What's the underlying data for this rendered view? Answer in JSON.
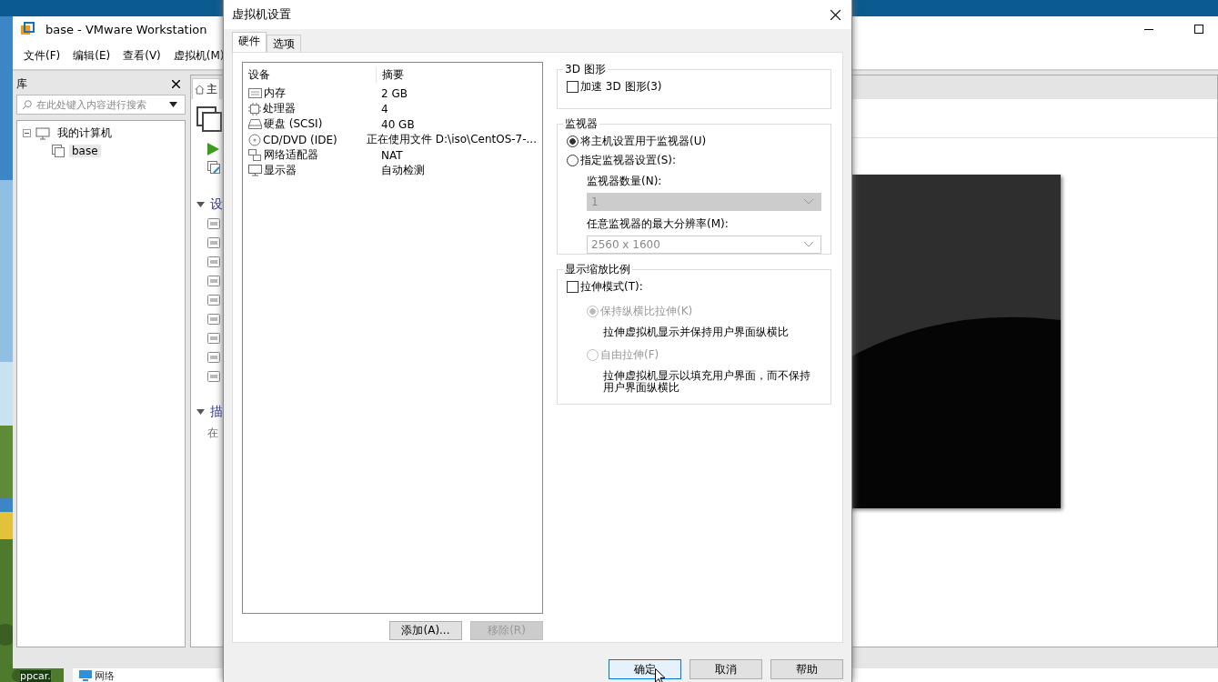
{
  "desktop": {
    "icons": [
      {
        "label": "ppcar."
      },
      {
        "label": "网络"
      }
    ]
  },
  "main_window": {
    "title": "base - VMware Workstation",
    "menu": [
      "文件(F)",
      "编辑(E)",
      "查看(V)",
      "虚拟机(M)"
    ],
    "library": {
      "title": "库",
      "search": {
        "placeholder": "在此处键入内容进行搜索"
      },
      "tree": [
        {
          "label": "我的计算机",
          "expanded": true,
          "selected": false,
          "children": [
            {
              "label": "base",
              "selected": true
            }
          ]
        }
      ]
    },
    "home_tab": {
      "label": "主"
    },
    "sections": [
      {
        "label": "设",
        "expanded": true
      },
      {
        "label": "描",
        "expanded": true,
        "text": "在"
      }
    ]
  },
  "dialog": {
    "title": "虚拟机设置",
    "tabs": [
      {
        "label": "硬件",
        "selected": true
      },
      {
        "label": "选项",
        "selected": false
      }
    ],
    "devices": {
      "columns": [
        "设备",
        "摘要"
      ],
      "rows": [
        {
          "kind": "memory",
          "name": "内存",
          "summary": "2 GB",
          "selected": false
        },
        {
          "kind": "cpu",
          "name": "处理器",
          "summary": "4",
          "selected": false
        },
        {
          "kind": "disk",
          "name": "硬盘 (SCSI)",
          "summary": "40 GB",
          "selected": false
        },
        {
          "kind": "cdrom",
          "name": "CD/DVD (IDE)",
          "summary": "正在使用文件 D:\\iso\\CentOS-7-...",
          "selected": false
        },
        {
          "kind": "network",
          "name": "网络适配器",
          "summary": "NAT",
          "selected": false
        },
        {
          "kind": "display",
          "name": "显示器",
          "summary": "自动检测",
          "selected": false
        }
      ]
    },
    "list_buttons": [
      {
        "label": "添加(A)...",
        "disabled": false
      },
      {
        "label": "移除(R)",
        "disabled": true
      }
    ],
    "graphics_3d": {
      "title": "3D 图形",
      "accelerate": {
        "label": "加速 3D 图形(3)",
        "checked": false
      }
    },
    "monitors": {
      "title": "监视器",
      "options": [
        {
          "label": "将主机设置用于监视器(U)",
          "selected": true
        },
        {
          "label": "指定监视器设置(S):",
          "selected": false
        }
      ],
      "count": {
        "label": "监视器数量(N):",
        "value": "1",
        "disabled": true
      },
      "max_resolution": {
        "label": "任意监视器的最大分辨率(M):",
        "value": "2560 x 1600",
        "disabled": true
      }
    },
    "scaling": {
      "title": "显示缩放比例",
      "stretch": {
        "label": "拉伸模式(T):",
        "checked": false
      },
      "options": [
        {
          "label": "保持纵横比拉伸(K)",
          "selected": true,
          "disabled": true,
          "description": "拉伸虚拟机显示并保持用户界面纵横比"
        },
        {
          "label": "自由拉伸(F)",
          "selected": false,
          "disabled": true,
          "description": "拉伸虚拟机显示以填充用户界面，而不保持用户界面纵横比"
        }
      ]
    },
    "buttons": [
      {
        "label": "确定",
        "default": true
      },
      {
        "label": "取消",
        "default": false
      },
      {
        "label": "帮助",
        "default": false
      }
    ]
  }
}
